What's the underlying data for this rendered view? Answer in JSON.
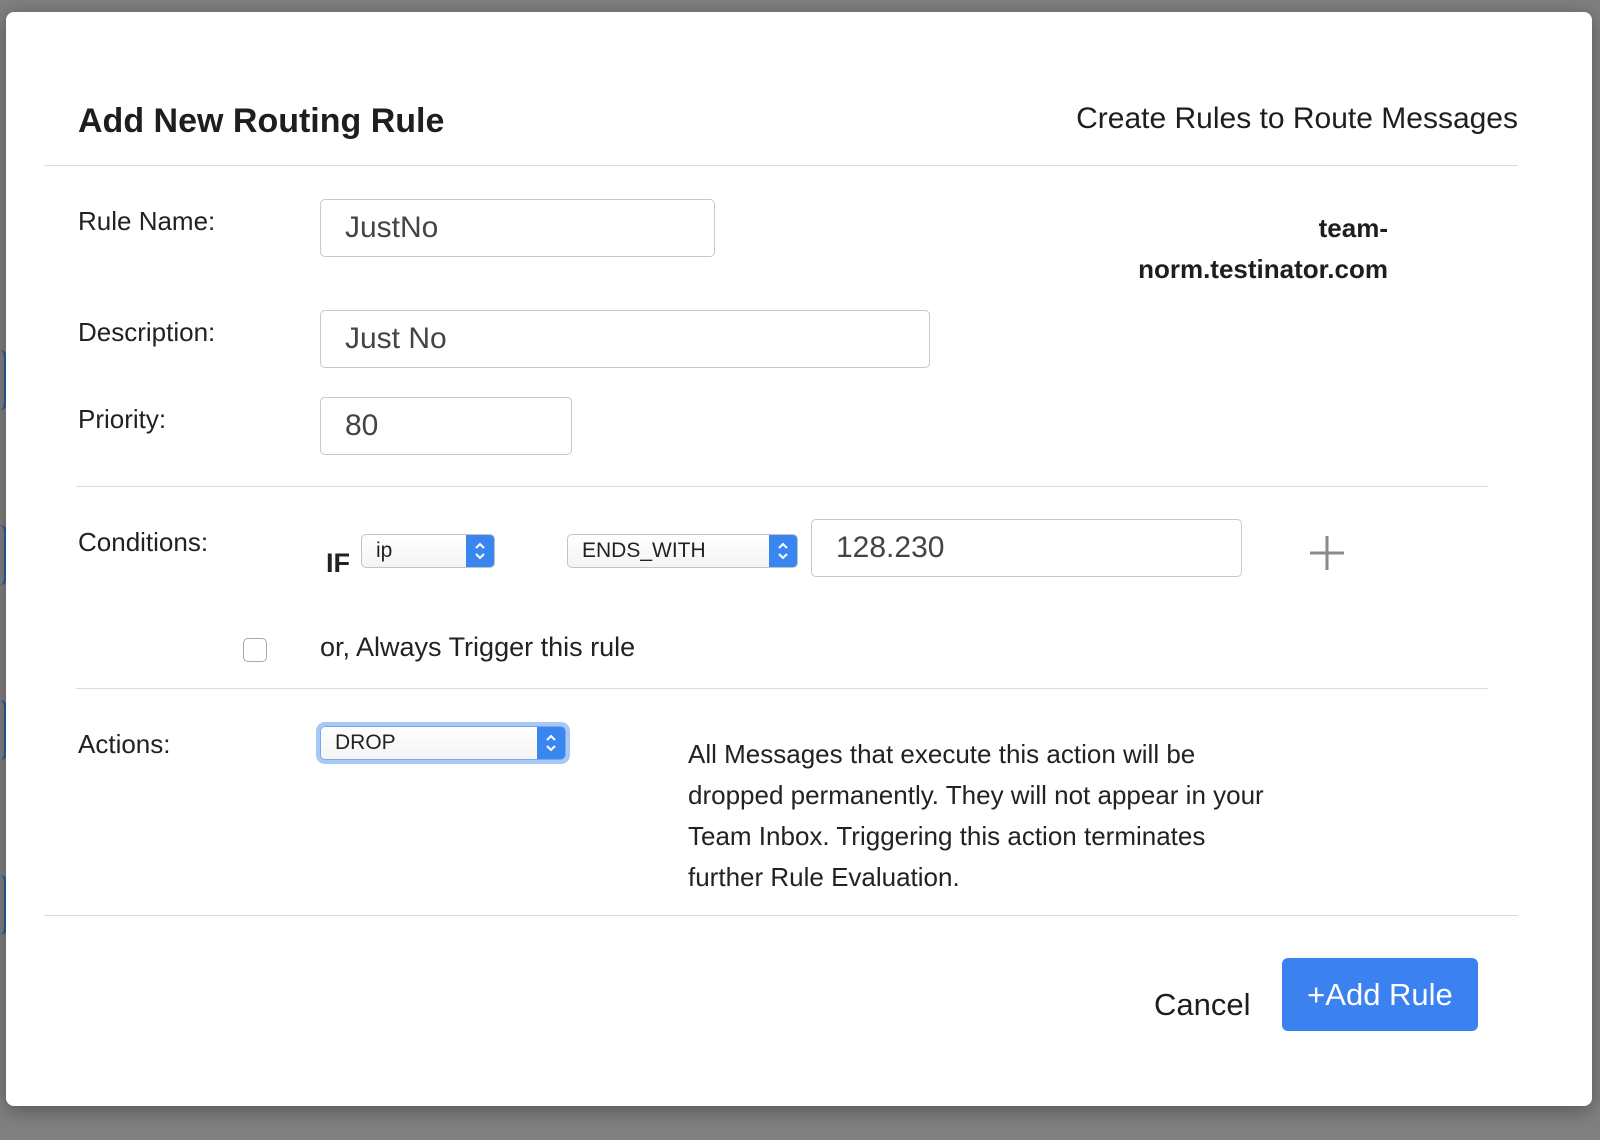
{
  "modal": {
    "title": "Add New Routing Rule",
    "subtitle": "Create Rules to Route Messages"
  },
  "form": {
    "rule_name_label": "Rule Name:",
    "rule_name_value": "JustNo",
    "domain": "team-norm.testinator.com",
    "description_label": "Description:",
    "description_value": "Just No",
    "priority_label": "Priority:",
    "priority_value": "80"
  },
  "conditions": {
    "label": "Conditions:",
    "if_label": "IF",
    "field_select": "ip",
    "operator_select": "ENDS_WITH",
    "value": "128.230",
    "always_trigger_label": "or, Always Trigger this rule",
    "always_trigger_checked": false
  },
  "actions": {
    "label": "Actions:",
    "action_select": "DROP",
    "description": "All Messages that execute this action will be dropped permanently. They will not appear in your Team Inbox. Triggering this action terminates further Rule Evaluation."
  },
  "footer": {
    "cancel_label": "Cancel",
    "add_label": "+Add Rule"
  },
  "colors": {
    "primary": "#3b82f0",
    "focus_ring": "#a8c8f8"
  }
}
